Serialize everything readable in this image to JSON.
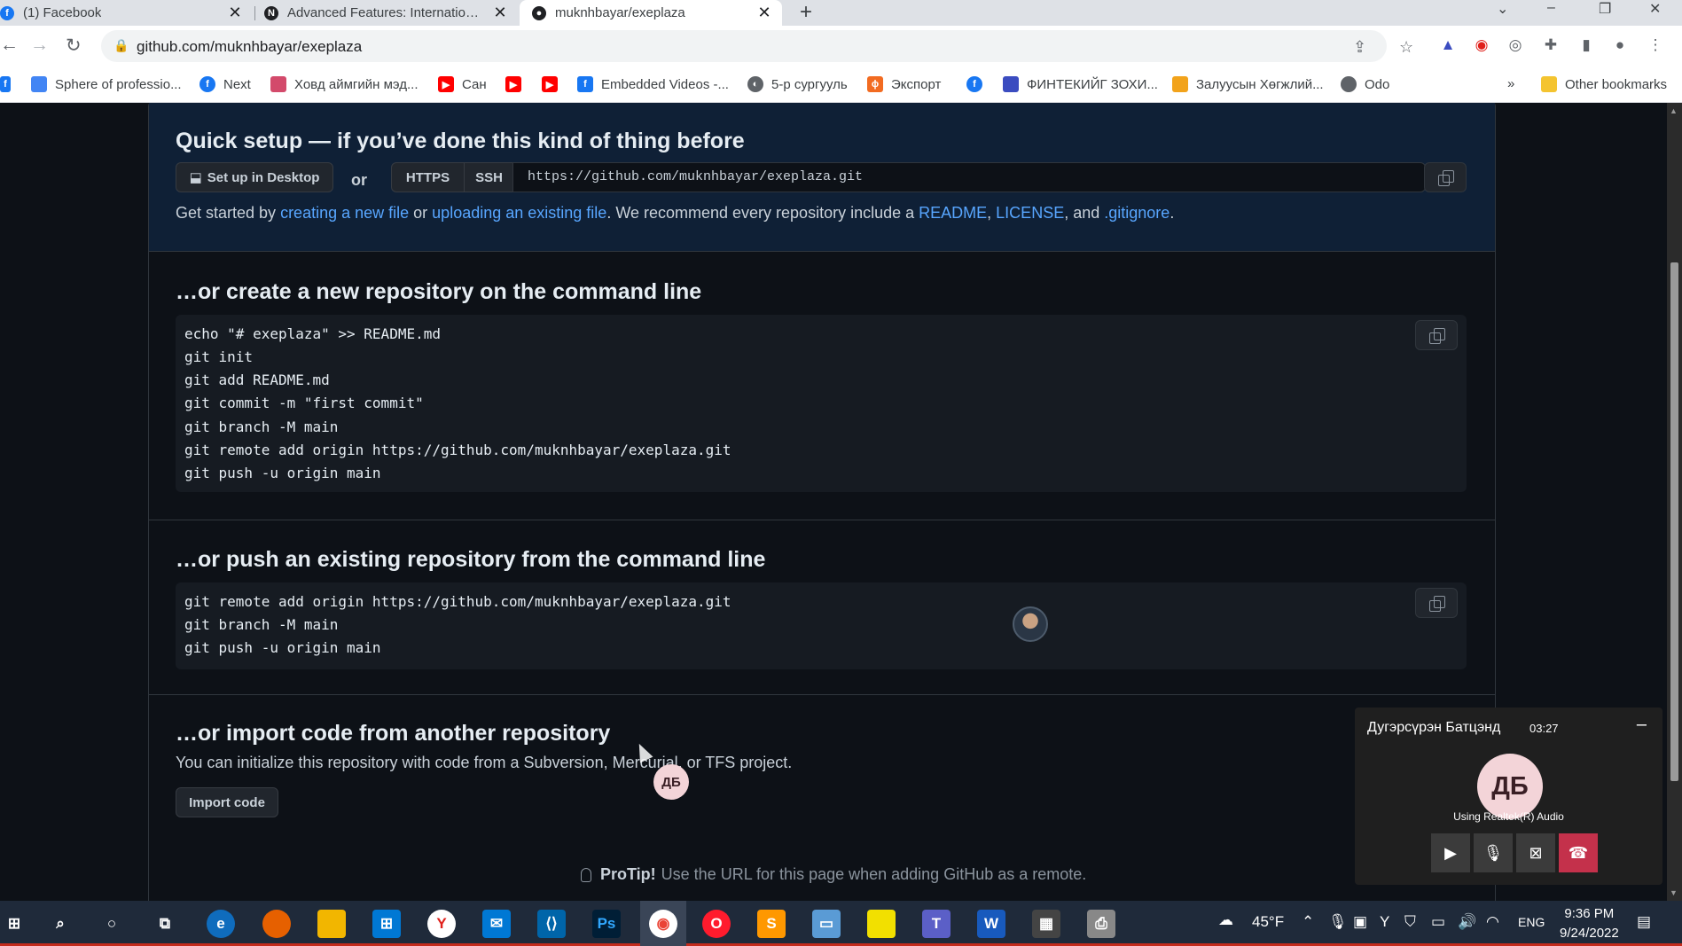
{
  "browser": {
    "tabs": [
      {
        "title": "(1) Facebook",
        "icon": "facebook-icon",
        "color": "#1877f2"
      },
      {
        "title": "Advanced Features: International",
        "icon": "n-logo-icon",
        "color": "#202124"
      },
      {
        "title": "muknhbayar/exeplaza",
        "icon": "github-icon",
        "color": "#202124"
      }
    ],
    "tab_close": "✕",
    "new_tab": "+",
    "url": "github.com/muknhbayar/exeplaza",
    "bookmarks": [
      {
        "label": "Sphere of professio...",
        "color": "#4285f4"
      },
      {
        "label": "Next",
        "color": "#1877f2"
      },
      {
        "label": "Ховд аймгийн мэд...",
        "color": "#d34a6b"
      },
      {
        "label": "Сан",
        "color": "#ff0000"
      },
      {
        "label": "",
        "color": "#ff0000"
      },
      {
        "label": "",
        "color": "#ff0000"
      },
      {
        "label": "Embedded Videos -...",
        "color": "#1877f2"
      },
      {
        "label": "5-р сургууль",
        "color": "#5f6368"
      },
      {
        "label": "Экспорт",
        "color": "#f26b21"
      },
      {
        "label": "",
        "color": "#1877f2"
      },
      {
        "label": "ФИНТЕКИЙГ ЗОХИ...",
        "color": "#3b4cc0"
      },
      {
        "label": "Залуусын Хөгжлий...",
        "color": "#f2a31b"
      },
      {
        "label": "Odo",
        "color": "#5f6368"
      }
    ],
    "bookmarks_more": "»",
    "other_bookmarks": "Other bookmarks"
  },
  "quick_setup": {
    "title": "Quick setup — if you’ve done this kind of thing before",
    "desktop_button": "Set up in Desktop",
    "or": "or",
    "https": "HTTPS",
    "ssh": "SSH",
    "clone_url": "https://github.com/muknhbayar/exeplaza.git",
    "get_started": {
      "p1": "Get started by ",
      "link1": "creating a new file",
      "p2": " or ",
      "link2": "uploading an existing file",
      "p3": ". We recommend every repository include a ",
      "link3": "README",
      "p4": ", ",
      "link4": "LICENSE",
      "p5": ", and ",
      "link5": ".gitignore",
      "p6": "."
    }
  },
  "new_repo": {
    "title": "…or create a new repository on the command line",
    "lines": [
      "echo \"# exeplaza\" >> README.md",
      "git init",
      "git add README.md",
      "git commit -m \"first commit\"",
      "git branch -M main",
      "git remote add origin https://github.com/muknhbayar/exeplaza.git",
      "git push -u origin main"
    ]
  },
  "push_repo": {
    "title": "…or push an existing repository from the command line",
    "lines": [
      "git remote add origin https://github.com/muknhbayar/exeplaza.git",
      "git branch -M main",
      "git push -u origin main"
    ]
  },
  "import": {
    "title": "…or import code from another repository",
    "desc": "You can initialize this repository with code from a Subversion, Mercurial, or TFS project.",
    "button": "Import code"
  },
  "protip": {
    "label": "ProTip!",
    "text": "Use the URL for this page when adding GitHub as a remote."
  },
  "call": {
    "name": "Дугэрсүрэн Батцэнд",
    "timer": "03:27",
    "initials": "ДБ",
    "audio": "Using Realtek(R) Audio",
    "minimize": "–"
  },
  "taskbar": {
    "weather": "45°F",
    "lang": "ENG",
    "time": "9:36 PM",
    "date": "9/24/2022"
  },
  "colors": {
    "page_bg": "#0d1117",
    "quick_bg": "#0f2036",
    "link": "#58a6ff",
    "end_call": "#c4314b"
  }
}
